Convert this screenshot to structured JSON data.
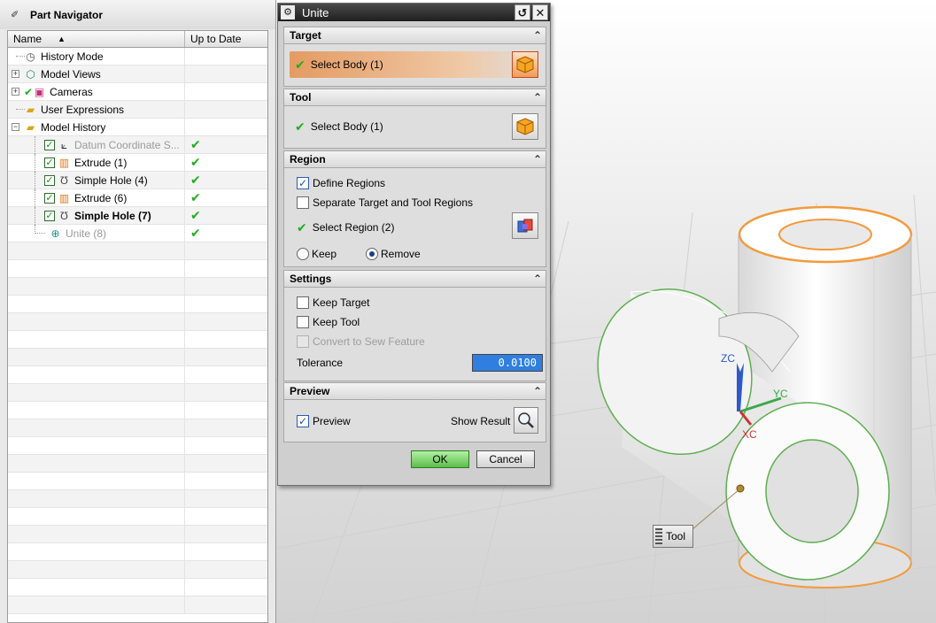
{
  "navigator": {
    "title": "Part Navigator",
    "columns": {
      "name": "Name",
      "up_to_date": "Up to Date"
    },
    "items": [
      {
        "label": "History Mode",
        "icon": "clock-icon"
      },
      {
        "label": "Model Views",
        "icon": "model-views-icon"
      },
      {
        "label": "Cameras",
        "icon": "camera-icon"
      },
      {
        "label": "User Expressions",
        "icon": "folder-icon"
      },
      {
        "label": "Model History",
        "icon": "folder-icon"
      },
      {
        "label": "Datum Coordinate S...",
        "icon": "datum-csys-icon",
        "status": "✔"
      },
      {
        "label": "Extrude (1)",
        "icon": "extrude-icon",
        "status": "✔"
      },
      {
        "label": "Simple Hole (4)",
        "icon": "hole-icon",
        "status": "✔"
      },
      {
        "label": "Extrude (6)",
        "icon": "extrude-icon",
        "status": "✔"
      },
      {
        "label": "Simple Hole (7)",
        "icon": "hole-icon",
        "status": "✔"
      },
      {
        "label": "Unite (8)",
        "icon": "unite-icon",
        "status": "✔"
      }
    ]
  },
  "dialog": {
    "title": "Unite",
    "target": {
      "header": "Target",
      "select_label": "Select Body (1)"
    },
    "tool": {
      "header": "Tool",
      "select_label": "Select Body (1)"
    },
    "region": {
      "header": "Region",
      "define_regions": "Define Regions",
      "separate_regions": "Separate Target and Tool Regions",
      "select_region": "Select Region (2)",
      "keep": "Keep",
      "remove": "Remove"
    },
    "settings": {
      "header": "Settings",
      "keep_target": "Keep Target",
      "keep_tool": "Keep Tool",
      "convert_sew": "Convert to Sew Feature",
      "tolerance_label": "Tolerance",
      "tolerance_value": "0.0100"
    },
    "preview": {
      "header": "Preview",
      "preview_label": "Preview",
      "show_result": "Show Result"
    },
    "ok": "OK",
    "cancel": "Cancel"
  },
  "viewport": {
    "axis_labels": {
      "z": "ZC",
      "y": "YC",
      "x": "XC"
    },
    "tool_tag": "Tool"
  },
  "colors": {
    "target_highlight": "#e49b62",
    "edge_orange": "#f39a3c",
    "edge_green": "#5fae4f",
    "ok_green": "#5dbd4b",
    "tolerance_blue": "#2f7fe0"
  }
}
